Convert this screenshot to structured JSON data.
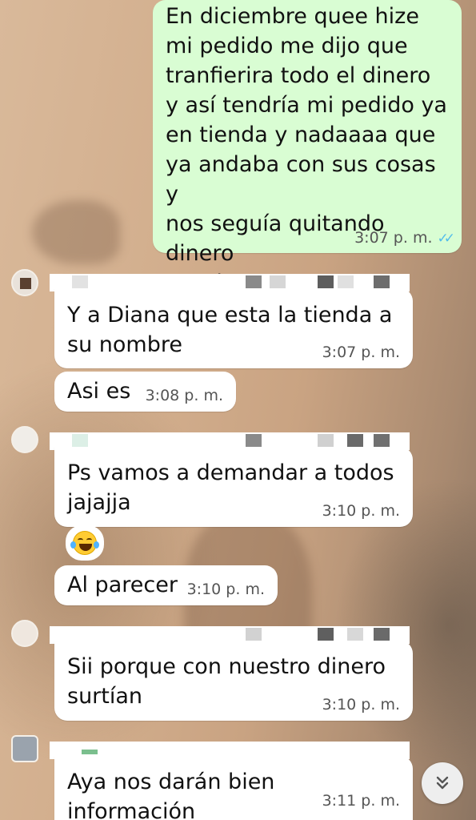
{
  "messages": [
    {
      "id": "m1",
      "direction": "out",
      "text": "En diciembre quee hize\nmi pedido me dijo que\ntranfierira todo el dinero\ny así tendría mi pedido ya\nen tienda y nadaaaa que\nya andaba con sus cosas y\nnos seguía quitando dinero\nQue horror",
      "time": "3:07 p. m.",
      "status": "read-double-check-icon"
    },
    {
      "id": "m2",
      "direction": "in",
      "text": "Y a Diana que esta la tienda a\nsu nombre",
      "time": "3:07 p. m."
    },
    {
      "id": "m3",
      "direction": "in",
      "text": "Asi es",
      "time": "3:08 p. m."
    },
    {
      "id": "m4",
      "direction": "in",
      "text": "Ps vamos a demandar a todos\njajajja",
      "time": "3:10 p. m."
    },
    {
      "id": "m5",
      "direction": "in",
      "text": "Al parecer",
      "time": "3:10 p. m."
    },
    {
      "id": "m6",
      "direction": "in",
      "text": "Sii porque con nuestro dinero\nsurtían",
      "time": "3:10 p. m."
    },
    {
      "id": "m7",
      "direction": "in",
      "text": "Aya nos darán bien información\nde que hace",
      "time": "3:11 p. m."
    }
  ],
  "reaction": {
    "emoji": "face-with-tears-of-joy-icon"
  },
  "scroll_button": {
    "icon": "double-chevron-down-icon"
  },
  "colors": {
    "outgoing_bubble": "#d9fdd3",
    "incoming_bubble": "#ffffff",
    "read_ticks": "#53bdeb",
    "timestamp": "#555555"
  }
}
